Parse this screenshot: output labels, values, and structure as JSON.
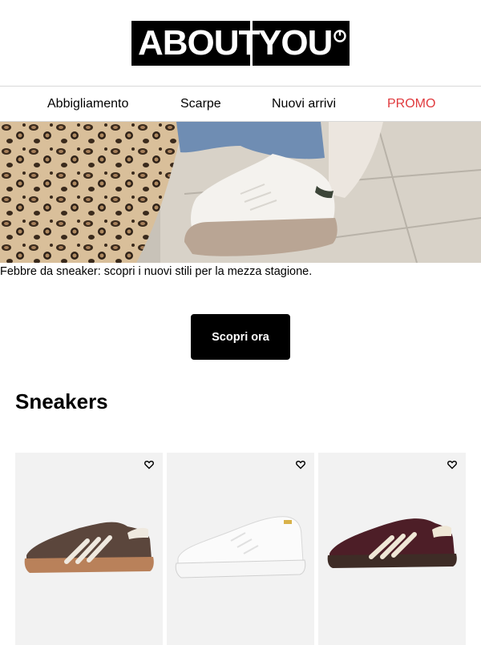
{
  "brand": {
    "logo_left": "ABOUT",
    "logo_right": "YOU"
  },
  "nav": [
    {
      "label": "Abbigliamento"
    },
    {
      "label": "Scarpe"
    },
    {
      "label": "Nuovi arrivi"
    },
    {
      "label": "PROMO"
    }
  ],
  "hero": {
    "caption": "Febbre da sneaker: scopri i nuovi stili per la mezza stagione."
  },
  "cta": {
    "label": "Scopri ora"
  },
  "section": {
    "title": "Sneakers"
  },
  "products": [
    {
      "icon": "heart-icon",
      "image": "brown-suede-sneaker"
    },
    {
      "icon": "heart-icon",
      "image": "white-leather-sneaker"
    },
    {
      "icon": "heart-icon",
      "image": "burgundy-suede-sneaker"
    }
  ],
  "colors": {
    "promo": "#e03a3e",
    "button": "#000000",
    "card_bg": "#f2f2f2"
  }
}
